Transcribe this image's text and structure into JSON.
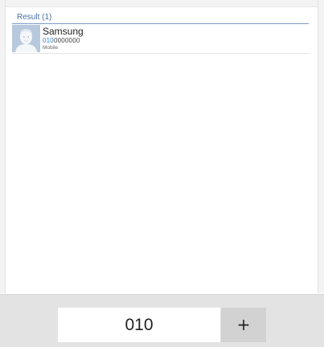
{
  "results": {
    "header": "Result (1)",
    "contacts": [
      {
        "name": "Samsung",
        "number_match": "010",
        "number_rest": "0000000",
        "type": "Mobile",
        "avatar_icon": "default-contact-avatar-icon"
      }
    ]
  },
  "dialer": {
    "value": "010",
    "plus_label": "+"
  },
  "colors": {
    "accent": "#2f7fd1",
    "header_text": "#4a6fa5",
    "avatar_bg": "#b8c9dd",
    "bottom_bar": "#e3e3e3"
  }
}
